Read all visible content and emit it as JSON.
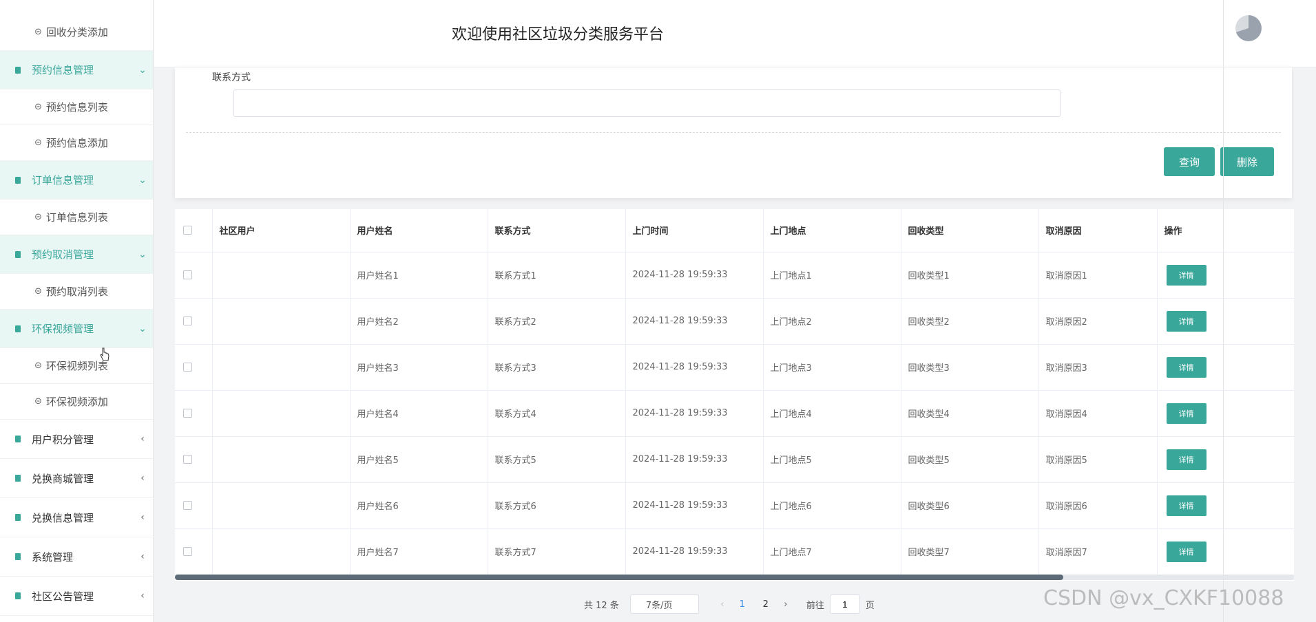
{
  "header": {
    "title": "欢迎使用社区垃圾分类服务平台"
  },
  "sidebar": {
    "top_item": "回收分类添加",
    "groups": [
      {
        "label": "预约信息管理",
        "open": true,
        "items": [
          "预约信息列表",
          "预约信息添加"
        ]
      },
      {
        "label": "订单信息管理",
        "open": true,
        "items": [
          "订单信息列表"
        ]
      },
      {
        "label": "预约取消管理",
        "open": true,
        "items": [
          "预约取消列表"
        ]
      },
      {
        "label": "环保视频管理",
        "open": true,
        "items": [
          "环保视频列表",
          "环保视频添加"
        ]
      },
      {
        "label": "用户积分管理",
        "open": false,
        "items": []
      },
      {
        "label": "兑换商城管理",
        "open": false,
        "items": []
      },
      {
        "label": "兑换信息管理",
        "open": false,
        "items": []
      },
      {
        "label": "系统管理",
        "open": false,
        "items": []
      },
      {
        "label": "社区公告管理",
        "open": false,
        "items": []
      }
    ],
    "open_chevron": "⌄",
    "closed_chevron": "‹",
    "circle_icon": "⊝"
  },
  "search": {
    "field_label": "联系方式",
    "field_value": "",
    "query_label": "查询",
    "delete_label": "删除"
  },
  "table": {
    "columns": [
      "社区用户",
      "用户姓名",
      "联系方式",
      "上门时间",
      "上门地点",
      "回收类型",
      "取消原因",
      "操作"
    ],
    "rows": [
      [
        "",
        "用户姓名1",
        "联系方式1",
        "2024-11-28 19:59:33",
        "上门地点1",
        "回收类型1",
        "取消原因1"
      ],
      [
        "",
        "用户姓名2",
        "联系方式2",
        "2024-11-28 19:59:33",
        "上门地点2",
        "回收类型2",
        "取消原因2"
      ],
      [
        "",
        "用户姓名3",
        "联系方式3",
        "2024-11-28 19:59:33",
        "上门地点3",
        "回收类型3",
        "取消原因3"
      ],
      [
        "",
        "用户姓名4",
        "联系方式4",
        "2024-11-28 19:59:33",
        "上门地点4",
        "回收类型4",
        "取消原因4"
      ],
      [
        "",
        "用户姓名5",
        "联系方式5",
        "2024-11-28 19:59:33",
        "上门地点5",
        "回收类型5",
        "取消原因5"
      ],
      [
        "",
        "用户姓名6",
        "联系方式6",
        "2024-11-28 19:59:33",
        "上门地点6",
        "回收类型6",
        "取消原因6"
      ],
      [
        "",
        "用户姓名7",
        "联系方式7",
        "2024-11-28 19:59:33",
        "上门地点7",
        "回收类型7",
        "取消原因7"
      ]
    ],
    "detail_label": "详情"
  },
  "pager": {
    "total": "共 12 条",
    "page_size": "7条/页",
    "pages": [
      "1",
      "2"
    ],
    "active_page": "1",
    "goto_label": "前往",
    "goto_value": "1",
    "page_suffix": "页",
    "prev_arrow": "‹",
    "next_arrow": "›"
  },
  "watermark": "CSDN @vx_CXKF10088",
  "colors": {
    "accent": "#3aa79b",
    "active_page": "#3a8ee6"
  }
}
